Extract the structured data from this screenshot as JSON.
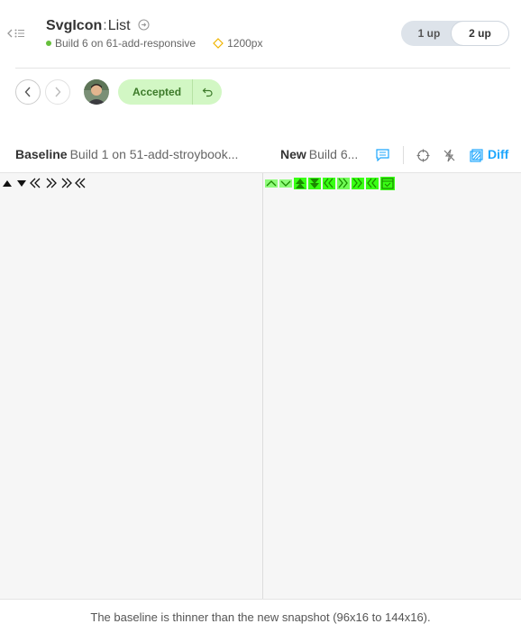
{
  "header": {
    "component": "SvgIcon",
    "separator": ":",
    "story": "List",
    "build_info": "Build 6 on 61-add-responsive",
    "viewport": "1200px"
  },
  "view_toggle": {
    "one_up": "1 up",
    "two_up": "2 up",
    "selected": "2 up"
  },
  "review": {
    "status": "Accepted"
  },
  "compare": {
    "baseline_label": "Baseline",
    "baseline_build": "Build 1 on 51-add-stroybook...",
    "new_label": "New",
    "new_build": "Build 6...",
    "diff_label": "Diff"
  },
  "footer": {
    "message": "The baseline is thinner than the new snapshot (96x16 to 144x16)."
  },
  "colors": {
    "accent": "#1ea7fd",
    "accepted_bg": "#d2f7c4",
    "accepted_text": "#3c7a29",
    "diff_highlight": "#39ff14",
    "status_green": "#66bf3c"
  }
}
